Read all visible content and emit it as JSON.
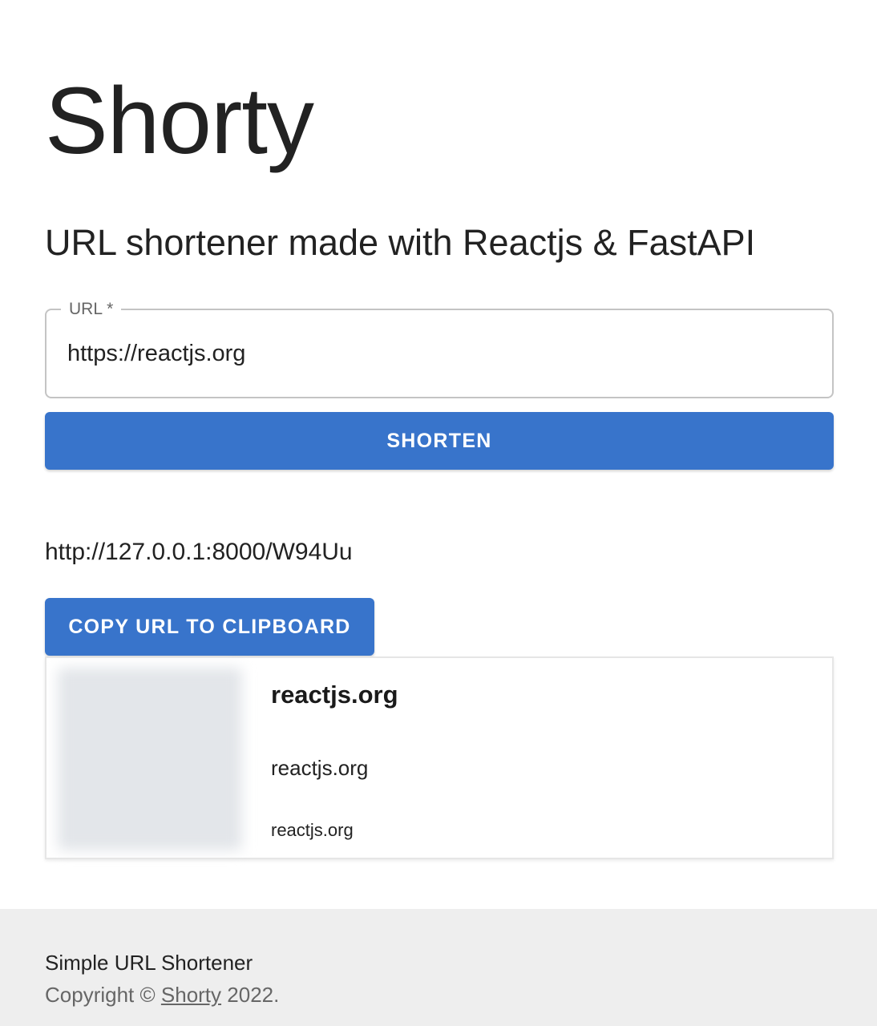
{
  "header": {
    "title": "Shorty",
    "subtitle": "URL shortener made with Reactjs & FastAPI"
  },
  "form": {
    "url_label": "URL *",
    "url_value": "https://reactjs.org",
    "shorten_label": "SHORTEN"
  },
  "result": {
    "short_url": "http://127.0.0.1:8000/W94Uu",
    "copy_label": "COPY URL TO CLIPBOARD"
  },
  "preview": {
    "title": "reactjs.org",
    "description": "reactjs.org",
    "domain": "reactjs.org"
  },
  "footer": {
    "title": "Simple URL Shortener",
    "copyright_prefix": "Copyright © ",
    "copyright_link": "Shorty",
    "copyright_suffix": " 2022."
  },
  "colors": {
    "primary": "#3874cb",
    "footer_bg": "#eeeeee"
  }
}
